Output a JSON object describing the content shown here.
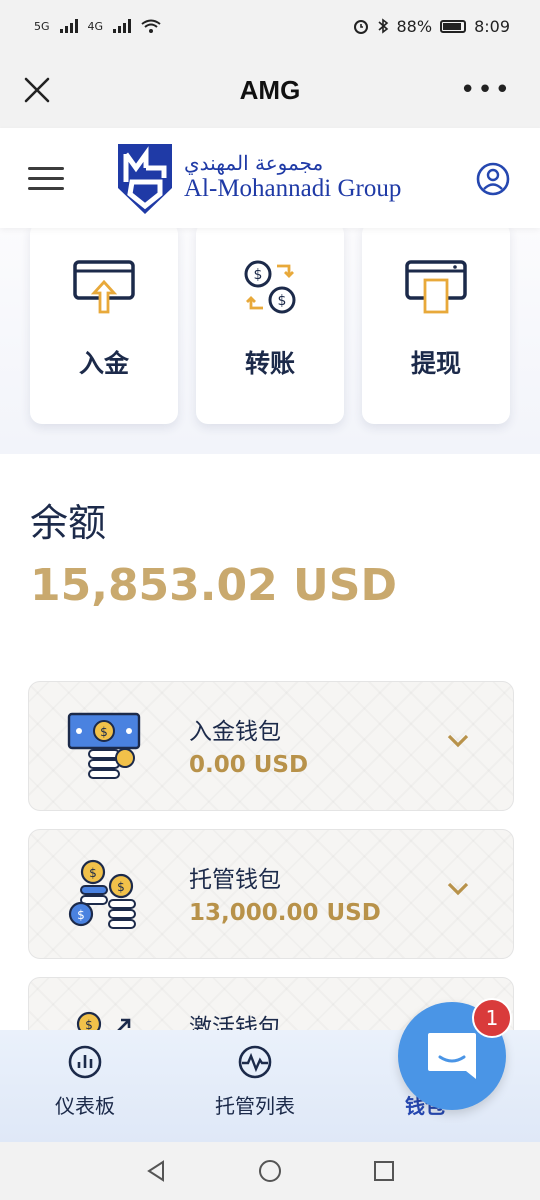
{
  "statusbar": {
    "network_left": "5G",
    "network_right": "4G",
    "battery": "88%",
    "time": "8:09"
  },
  "webview": {
    "title": "AMG",
    "more": "•••"
  },
  "header": {
    "logo_arabic": "مجموعة المهندي",
    "logo_english": "Al-Mohannadi Group"
  },
  "actions": [
    {
      "label": "入金",
      "icon": "deposit-card-icon"
    },
    {
      "label": "转账",
      "icon": "transfer-coins-icon"
    },
    {
      "label": "提现",
      "icon": "withdraw-card-icon"
    }
  ],
  "balance": {
    "label": "余额",
    "value": "15,853.02 USD"
  },
  "wallets": [
    {
      "name": "入金钱包",
      "value": "0.00 USD",
      "icon": "cash-stack-icon"
    },
    {
      "name": "托管钱包",
      "value": "13,000.00 USD",
      "icon": "coin-stacks-icon"
    },
    {
      "name": "激活钱包",
      "value": "",
      "icon": "coin-growth-icon"
    }
  ],
  "tabbar": [
    {
      "label": "仪表板",
      "icon": "dashboard-icon"
    },
    {
      "label": "托管列表",
      "icon": "pulse-icon"
    },
    {
      "label": "钱包",
      "icon": "wallet-icon"
    }
  ],
  "chat": {
    "badge": "1"
  },
  "colors": {
    "gold": "#c9a96e",
    "navy": "#1c2a4a",
    "brand_blue": "#1f3aa6",
    "chat_blue": "#4a95e6",
    "badge_red": "#d93b3b"
  }
}
